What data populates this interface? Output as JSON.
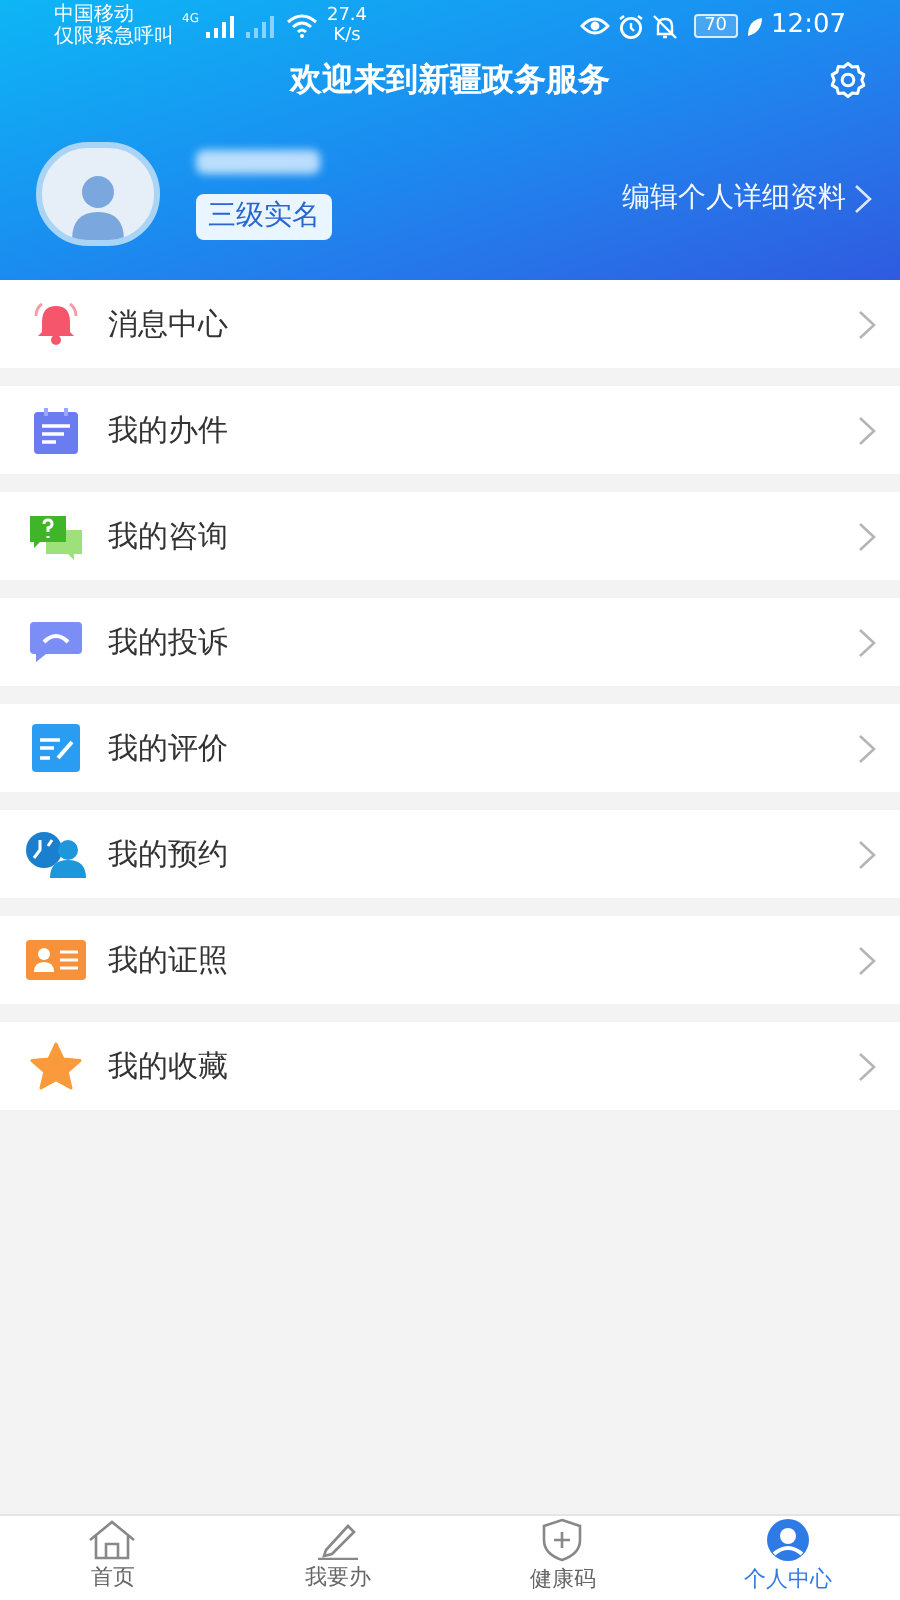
{
  "status_bar": {
    "carrier": "中国移动",
    "carrier_note": "仅限紧急呼叫",
    "network": "4G",
    "speed": "27.4",
    "speed_unit": "K/s",
    "battery": "70",
    "time": "12:07"
  },
  "header": {
    "title": "欢迎来到新疆政务服务",
    "verification": "三级实名",
    "edit_profile": "编辑个人详细资料"
  },
  "menu": [
    {
      "kind": "bell",
      "label": "消息中心"
    },
    {
      "kind": "clipboard",
      "label": "我的办件"
    },
    {
      "kind": "question",
      "label": "我的咨询"
    },
    {
      "kind": "complaint",
      "label": "我的投诉"
    },
    {
      "kind": "review",
      "label": "我的评价"
    },
    {
      "kind": "appointment",
      "label": "我的预约"
    },
    {
      "kind": "license",
      "label": "我的证照"
    },
    {
      "kind": "star",
      "label": "我的收藏"
    }
  ],
  "tab_bar": [
    {
      "kind": "home",
      "label": "首页",
      "selected": false
    },
    {
      "kind": "pen",
      "label": "我要办",
      "selected": false
    },
    {
      "kind": "shield",
      "label": "健康码",
      "selected": false
    },
    {
      "kind": "person",
      "label": "个人中心",
      "selected": true
    }
  ]
}
